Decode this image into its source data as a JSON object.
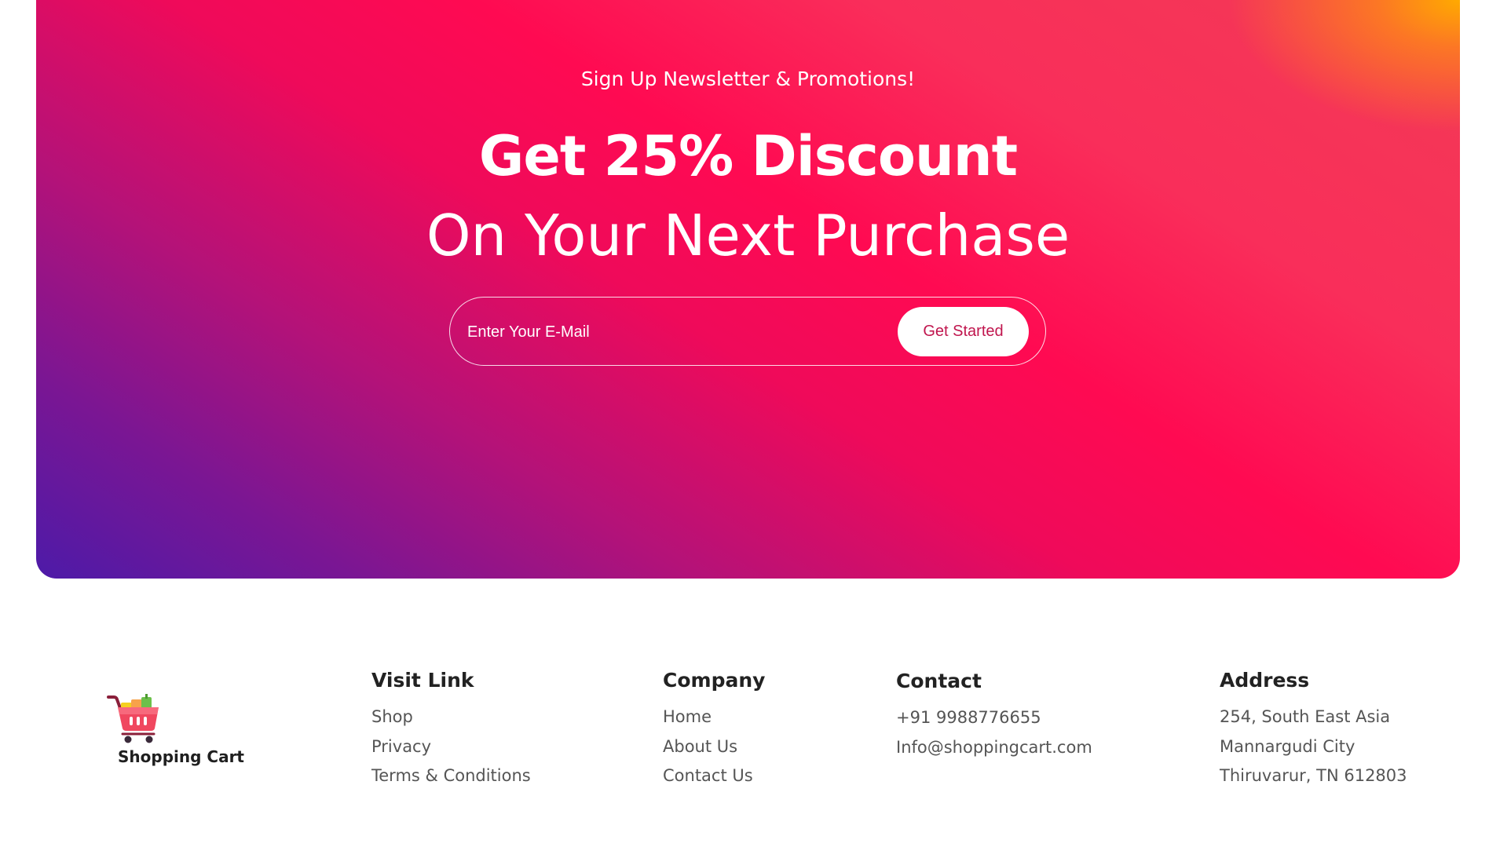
{
  "banner": {
    "eyebrow": "Sign Up Newsletter & Promotions!",
    "headline_bold": "Get 25% Discount",
    "headline_light": "On Your Next Purchase",
    "email_placeholder": "Enter Your E-Mail",
    "cta_label": "Get Started",
    "colors": {
      "gradient_purple": "#4d1aa8",
      "gradient_pink": "#ff0a52",
      "gradient_orange": "#ffaa00",
      "cta_text": "#c0164e"
    }
  },
  "footer": {
    "brand": {
      "name": "Shopping Cart",
      "logo_icon": "shopping-cart-icon"
    },
    "visit_link": {
      "heading": "Visit Link",
      "items": [
        "Shop",
        "Privacy",
        "Terms & Conditions"
      ]
    },
    "company": {
      "heading": "Company",
      "items": [
        "Home",
        "About Us",
        "Contact Us"
      ]
    },
    "contact": {
      "heading": "Contact",
      "items": [
        "+91 9988776655",
        "Info@shoppingcart.com"
      ]
    },
    "address": {
      "heading": "Address",
      "items": [
        "254, South East Asia",
        "Mannargudi City",
        "Thiruvarur, TN 612803"
      ]
    }
  }
}
